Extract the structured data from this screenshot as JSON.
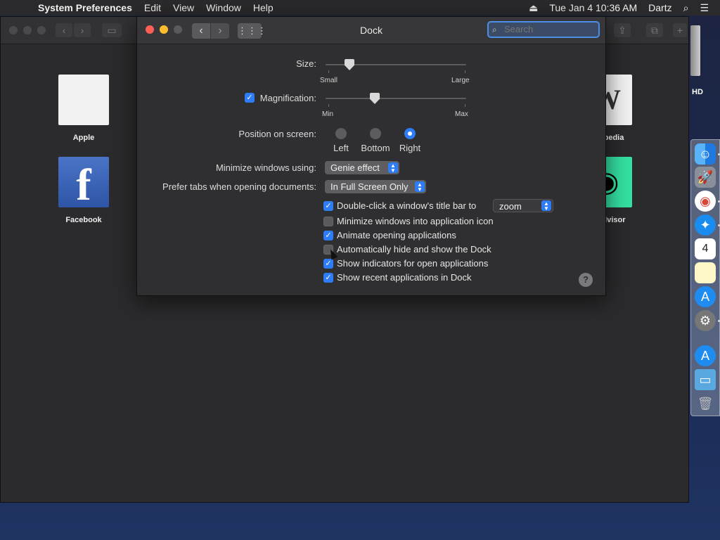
{
  "menubar": {
    "app_name": "System Preferences",
    "menus": [
      "Edit",
      "View",
      "Window",
      "Help"
    ],
    "datetime": "Tue Jan 4  10:36 AM",
    "user": "Dartz"
  },
  "background_window": {
    "favorites": [
      {
        "label": "Apple"
      },
      {
        "label": "Facebook"
      },
      {
        "label": "pedia"
      },
      {
        "label": "dvisor"
      }
    ],
    "tile_glyphs": {
      "facebook": "f",
      "wikipedia": "W"
    }
  },
  "desktop": {
    "hd_label": "HD"
  },
  "dock_prefs": {
    "title": "Dock",
    "search_placeholder": "Search",
    "size": {
      "label": "Size:",
      "min_label": "Small",
      "max_label": "Large",
      "value": 0.17
    },
    "magnification": {
      "label": "Magnification:",
      "checked": true,
      "min_label": "Min",
      "max_label": "Max",
      "value": 0.35
    },
    "position": {
      "label": "Position on screen:",
      "options": [
        "Left",
        "Bottom",
        "Right"
      ],
      "selected": "Right"
    },
    "minimize": {
      "label": "Minimize windows using:",
      "value": "Genie effect"
    },
    "prefer_tabs": {
      "label": "Prefer tabs when opening documents:",
      "value": "In Full Screen Only"
    },
    "double_click": {
      "label": "Double-click a window's title bar to",
      "checked": true,
      "value": "zoom"
    },
    "options": [
      {
        "label": "Minimize windows into application icon",
        "checked": false
      },
      {
        "label": "Animate opening applications",
        "checked": true
      },
      {
        "label": "Automatically hide and show the Dock",
        "checked": false
      },
      {
        "label": "Show indicators for open applications",
        "checked": true
      },
      {
        "label": "Show recent applications in Dock",
        "checked": true
      }
    ],
    "help": "?"
  },
  "dock": {
    "calendar_day": "4",
    "items": [
      "finder-icon",
      "launchpad-icon",
      "chrome-icon",
      "safari-icon",
      "calendar-icon",
      "notes-icon",
      "app-store-icon",
      "system-preferences-icon",
      "app-store-icon",
      "downloads-folder-icon",
      "trash-icon"
    ]
  },
  "colors": {
    "accent": "#2e7cf6",
    "close": "#fe5f57",
    "minimize": "#febc2e"
  }
}
